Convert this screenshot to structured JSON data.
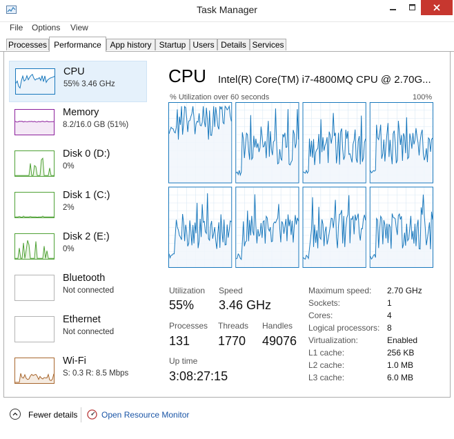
{
  "window": {
    "title": "Task Manager"
  },
  "menu": [
    "File",
    "Options",
    "View"
  ],
  "tabs": [
    "Processes",
    "Performance",
    "App history",
    "Startup",
    "Users",
    "Details",
    "Services"
  ],
  "active_tab": "Performance",
  "sidebar": [
    {
      "title": "CPU",
      "sub": "55%  3.46 GHz",
      "color": "#1777bc",
      "graph": "cpu"
    },
    {
      "title": "Memory",
      "sub": "8.2/16.0 GB (51%)",
      "color": "#8b1d9b",
      "graph": "memory"
    },
    {
      "title": "Disk 0 (D:)",
      "sub": "0%",
      "color": "#4da033",
      "graph": "disk0"
    },
    {
      "title": "Disk 1 (C:)",
      "sub": "2%",
      "color": "#4da033",
      "graph": "disk1"
    },
    {
      "title": "Disk 2 (E:)",
      "sub": "0%",
      "color": "#4da033",
      "graph": "disk2"
    },
    {
      "title": "Bluetooth",
      "sub": "Not connected",
      "color": "#b3b3b3",
      "graph": "none"
    },
    {
      "title": "Ethernet",
      "sub": "Not connected",
      "color": "#b3b3b3",
      "graph": "none"
    },
    {
      "title": "Wi-Fi",
      "sub": "S: 0.3  R: 8.5 Mbps",
      "color": "#a7652b",
      "graph": "wifi"
    }
  ],
  "main": {
    "title": "CPU",
    "model": "Intel(R) Core(TM) i7-4800MQ CPU @ 2.70G...",
    "graph_label": "% Utilization over 60 seconds",
    "graph_max": "100%",
    "accent": "#1777bc",
    "fill": "#f1f6fb",
    "grid": "#d9e8f4"
  },
  "stats": {
    "utilization_label": "Utilization",
    "utilization": "55%",
    "speed_label": "Speed",
    "speed": "3.46 GHz",
    "processes_label": "Processes",
    "processes": "131",
    "threads_label": "Threads",
    "threads": "1770",
    "handles_label": "Handles",
    "handles": "49076",
    "uptime_label": "Up time",
    "uptime": "3:08:27:15"
  },
  "specs": [
    {
      "label": "Maximum speed:",
      "value": "2.70 GHz"
    },
    {
      "label": "Sockets:",
      "value": "1"
    },
    {
      "label": "Cores:",
      "value": "4"
    },
    {
      "label": "Logical processors:",
      "value": "8"
    },
    {
      "label": "Virtualization:",
      "value": "Enabled"
    },
    {
      "label": "L1 cache:",
      "value": "256 KB"
    },
    {
      "label": "L2 cache:",
      "value": "1.0 MB"
    },
    {
      "label": "L3 cache:",
      "value": "6.0 MB"
    }
  ],
  "footer": {
    "fewer_details": "Fewer details",
    "resource_monitor": "Open Resource Monitor"
  },
  "icons": {
    "app": "task-manager-icon",
    "minimize": "minimize-icon",
    "maximize": "maximize-icon",
    "close": "close-icon",
    "fewer": "chevron-up-icon",
    "resource": "resource-monitor-icon"
  }
}
